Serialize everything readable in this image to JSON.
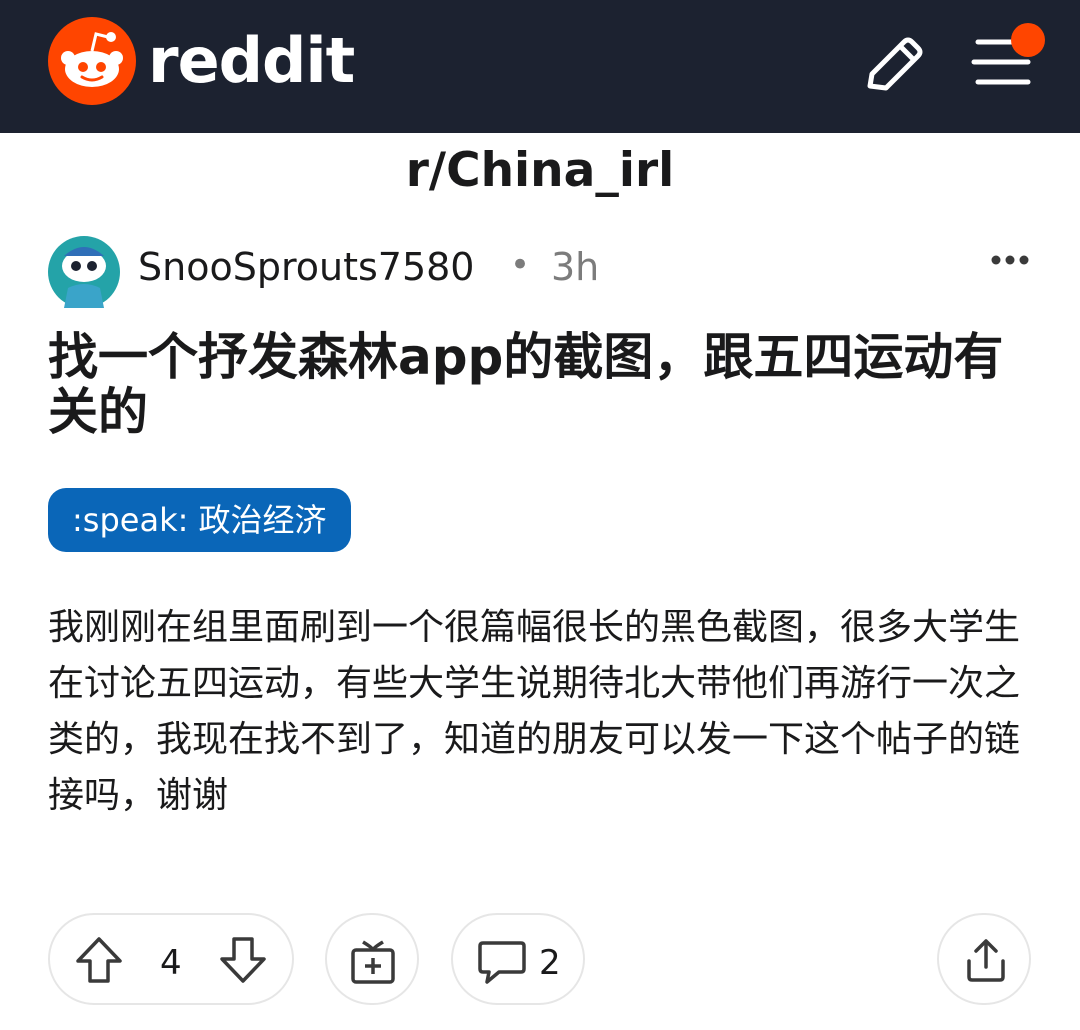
{
  "header": {
    "logo_text": "reddit",
    "brand_color": "#ff4500",
    "bar_color": "#1c2230",
    "edit_icon": "pencil-icon",
    "menu_icon": "hamburger-menu-icon",
    "notification_dot_color": "#ff4500"
  },
  "subreddit": {
    "name": "r/China_irl"
  },
  "post": {
    "author": "SnooSprouts7580",
    "separator": "•",
    "time": "3h",
    "title": "找一个抒发森林app的截图，跟五四运动有关的",
    "flair": ":speak: 政治经济",
    "flair_color": "#0a66b8",
    "body": "我刚刚在组里面刷到一个很篇幅很长的黑色截图，很多大学生在讨论五四运动，有些大学生说期待北大带他们再游行一次之类的，我现在找不到了，知道的朋友可以发一下这个帖子的链接吗，谢谢"
  },
  "actions": {
    "vote_count": "4",
    "comment_count": "2"
  }
}
